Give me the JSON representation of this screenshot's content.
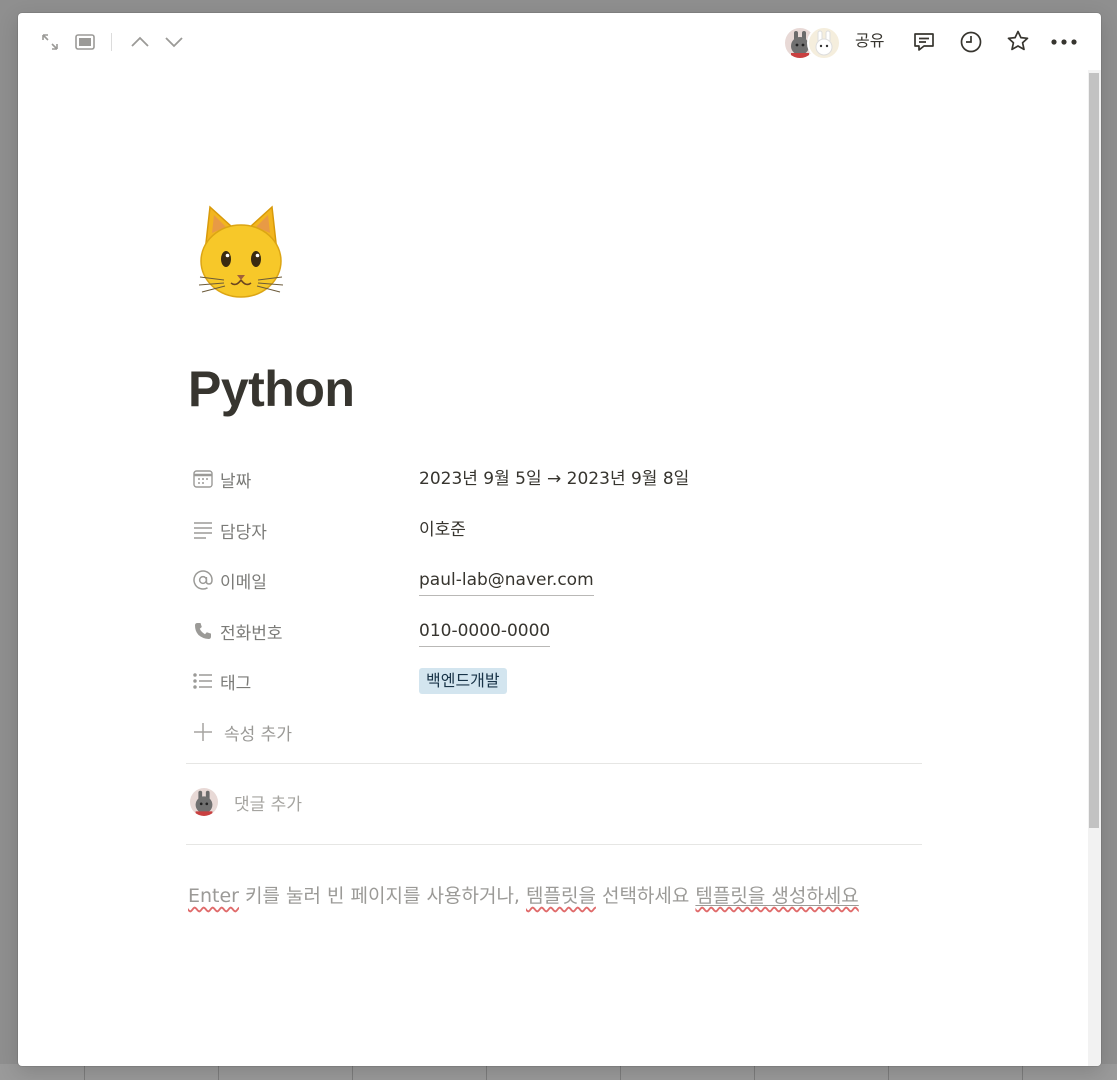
{
  "topbar": {
    "share_label": "공유",
    "icons": [
      "expand-icon",
      "side-peek-icon",
      "chevron-up-icon",
      "chevron-down-icon",
      "comment-icon",
      "clock-icon",
      "star-icon",
      "more-icon"
    ]
  },
  "page": {
    "icon": "cat-face-emoji",
    "title": "Python"
  },
  "properties": [
    {
      "icon": "calendar-icon",
      "label": "날짜",
      "value": "2023년 9월 5일 → 2023년 9월 8일"
    },
    {
      "icon": "text-lines-icon",
      "label": "담당자",
      "value": "이호준"
    },
    {
      "icon": "at-icon",
      "label": "이메일",
      "value": "paul-lab@naver.com"
    },
    {
      "icon": "phone-icon",
      "label": "전화번호",
      "value": "010-0000-0000"
    },
    {
      "icon": "list-icon",
      "label": "태그",
      "value": "백엔드개발"
    }
  ],
  "add_property_label": "속성 추가",
  "comment": {
    "placeholder": "댓글 추가"
  },
  "hint": {
    "enter": "Enter",
    "part1": " 키를 눌러 빈 페이지를 사용하거나, ",
    "template_word": "템플릿을",
    "part2": " 선택하세요 ",
    "create_link": "템플릿을 생성하세요"
  },
  "colors": {
    "accent_tag_bg": "#d3e5ef",
    "text": "#37352f",
    "muted": "#9b9a97"
  }
}
